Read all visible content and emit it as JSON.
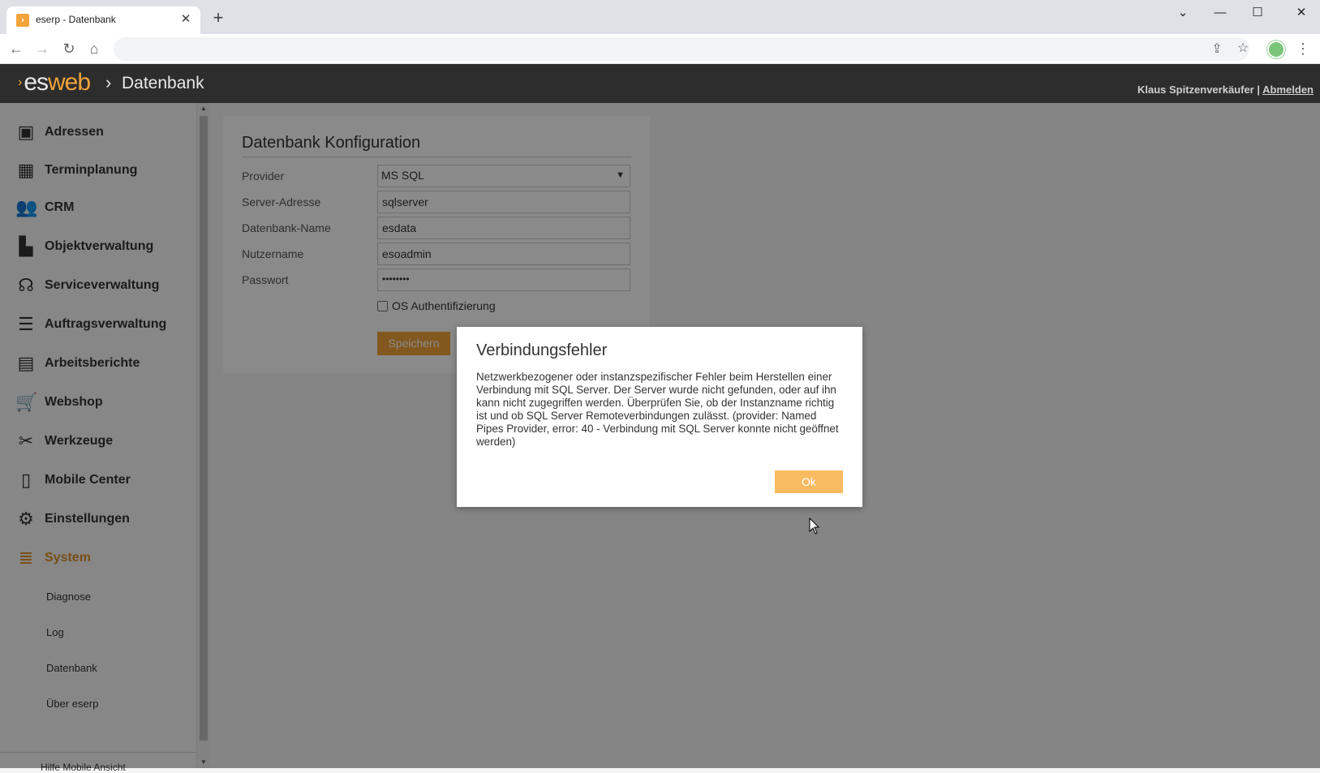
{
  "browser": {
    "tab_title": "eserp - Datenbank",
    "favicon_icon": "eserp-favicon-icon",
    "new_tab_label": "+",
    "address": ""
  },
  "header": {
    "logo_es": "es",
    "logo_web": "web",
    "breadcrumb_separator": "›",
    "breadcrumb": "Datenbank",
    "user": "Klaus Spitzenverkäufer",
    "separator": "|",
    "logout": "Abmelden"
  },
  "sidebar": {
    "items": [
      {
        "label": "Adressen",
        "icon": "address-book-icon"
      },
      {
        "label": "Terminplanung",
        "icon": "calendar-icon"
      },
      {
        "label": "CRM",
        "icon": "users-icon"
      },
      {
        "label": "Objektverwaltung",
        "icon": "factory-icon"
      },
      {
        "label": "Serviceverwaltung",
        "icon": "headset-icon"
      },
      {
        "label": "Auftragsverwaltung",
        "icon": "list-icon"
      },
      {
        "label": "Arbeitsberichte",
        "icon": "clipboard-icon"
      },
      {
        "label": "Webshop",
        "icon": "cart-icon"
      },
      {
        "label": "Werkzeuge",
        "icon": "tools-icon"
      },
      {
        "label": "Mobile Center",
        "icon": "mobile-icon"
      },
      {
        "label": "Einstellungen",
        "icon": "gears-icon"
      },
      {
        "label": "System",
        "icon": "database-icon"
      }
    ],
    "subitems": [
      "Diagnose",
      "Log",
      "Datenbank",
      "Über eserp"
    ],
    "footer": "Hilfe    Mobile Ansicht"
  },
  "form": {
    "title": "Datenbank Konfiguration",
    "provider_label": "Provider",
    "provider_value": "MS SQL",
    "server_label": "Server-Adresse",
    "server_value": "sqlserver",
    "dbname_label": "Datenbank-Name",
    "dbname_value": "esdata",
    "user_label": "Nutzername",
    "user_value": "esoadmin",
    "password_label": "Passwort",
    "password_value": "••••••••",
    "os_auth_label": "OS Authentifizierung",
    "save_label": "Speichern"
  },
  "dialog": {
    "title": "Verbindungsfehler",
    "message": "Netzwerkbezogener oder instanzspezifischer Fehler beim Herstellen einer Verbindung mit SQL Server. Der Server wurde nicht gefunden, oder auf ihn kann nicht zugegriffen werden. Überprüfen Sie, ob der Instanzname richtig ist und ob SQL Server Remoteverbindungen zulässt. (provider: Named Pipes Provider, error: 40 - Verbindung mit SQL Server konnte nicht geöffnet werden)",
    "ok_label": "Ok"
  },
  "colors": {
    "accent": "#f2a33a",
    "header_bg": "#2d2d2d",
    "ok_button": "#f9bb62"
  }
}
